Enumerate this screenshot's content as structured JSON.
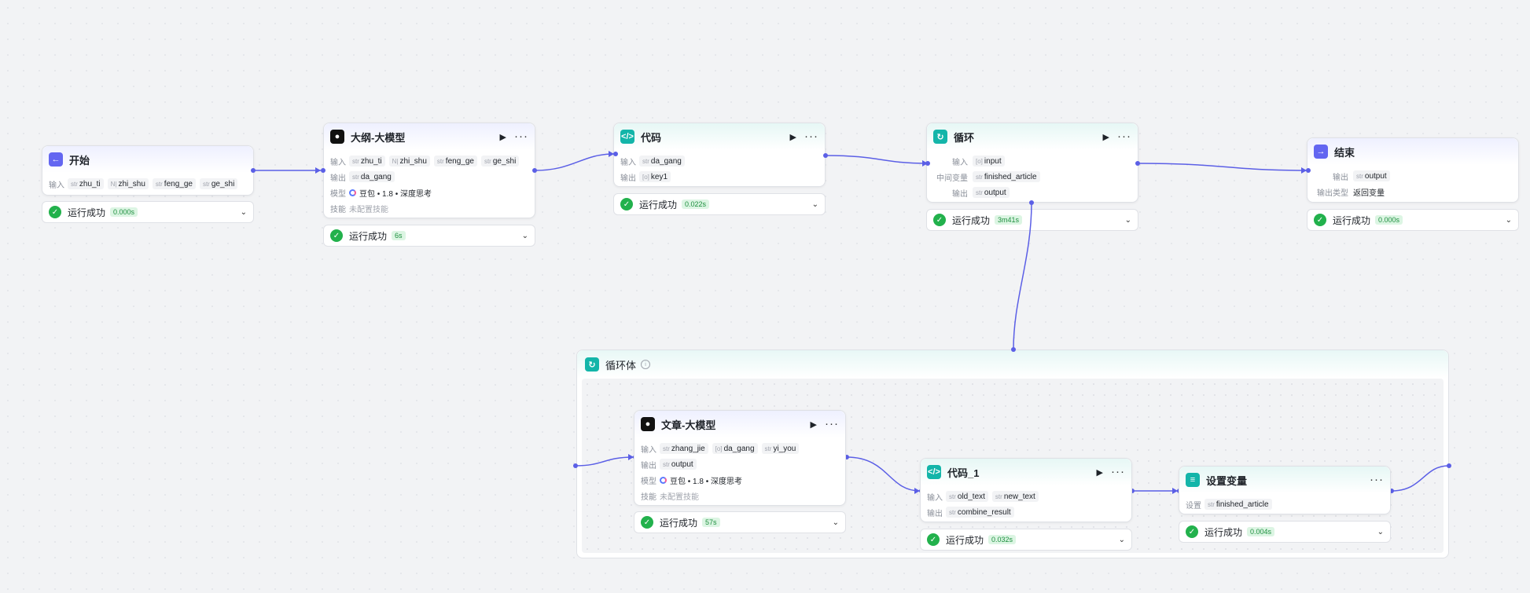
{
  "labels": {
    "input": "输入",
    "output": "输出",
    "model": "模型",
    "skills": "技能",
    "setting": "设置",
    "mid_var": "中间变量",
    "out_type": "输出类型"
  },
  "nodes": {
    "start": {
      "title": "开始",
      "inputs": [
        {
          "t": "str",
          "n": "zhu_ti"
        },
        {
          "t": "N|",
          "n": "zhi_shu"
        },
        {
          "t": "str",
          "n": "feng_ge"
        },
        {
          "t": "str",
          "n": "ge_shi"
        }
      ],
      "status": "运行成功",
      "duration": "0.000s"
    },
    "outline": {
      "title": "大纲-大模型",
      "inputs": [
        {
          "t": "str",
          "n": "zhu_ti"
        },
        {
          "t": "N|",
          "n": "zhi_shu"
        },
        {
          "t": "str",
          "n": "feng_ge"
        },
        {
          "t": "str",
          "n": "ge_shi"
        }
      ],
      "outputs": [
        {
          "t": "str",
          "n": "da_gang"
        }
      ],
      "model": "豆包 • 1.8 • 深度思考",
      "skills": "未配置技能",
      "status": "运行成功",
      "duration": "6s"
    },
    "code": {
      "title": "代码",
      "inputs": [
        {
          "t": "str",
          "n": "da_gang"
        }
      ],
      "outputs": [
        {
          "t": "[o]",
          "n": "key1"
        }
      ],
      "status": "运行成功",
      "duration": "0.022s"
    },
    "loop": {
      "title": "循环",
      "inputs": [
        {
          "t": "[o]",
          "n": "input"
        }
      ],
      "mid": [
        {
          "t": "str",
          "n": "finished_article"
        }
      ],
      "outputs": [
        {
          "t": "str",
          "n": "output"
        }
      ],
      "status": "运行成功",
      "duration": "3m41s"
    },
    "end": {
      "title": "结束",
      "outputs": [
        {
          "t": "str",
          "n": "output"
        }
      ],
      "out_type": "返回变量",
      "status": "运行成功",
      "duration": "0.000s"
    },
    "loop_body": {
      "title": "循环体"
    },
    "article": {
      "title": "文章-大模型",
      "inputs": [
        {
          "t": "str",
          "n": "zhang_jie"
        },
        {
          "t": "[o]",
          "n": "da_gang"
        },
        {
          "t": "str",
          "n": "yi_you"
        }
      ],
      "outputs": [
        {
          "t": "str",
          "n": "output"
        }
      ],
      "model": "豆包 • 1.8 • 深度思考",
      "skills": "未配置技能",
      "status": "运行成功",
      "duration": "57s"
    },
    "code1": {
      "title": "代码_1",
      "inputs": [
        {
          "t": "str",
          "n": "old_text"
        },
        {
          "t": "str",
          "n": "new_text"
        }
      ],
      "outputs": [
        {
          "t": "str",
          "n": "combine_result"
        }
      ],
      "status": "运行成功",
      "duration": "0.032s"
    },
    "setvar": {
      "title": "设置变量",
      "settings": [
        {
          "t": "str",
          "n": "finished_article"
        }
      ],
      "status": "运行成功",
      "duration": "0.004s"
    }
  },
  "colors": {
    "edge": "#5b5fe6",
    "success": "#22b14c",
    "accent_purple": "#6366f1",
    "accent_teal": "#13b5a9"
  }
}
